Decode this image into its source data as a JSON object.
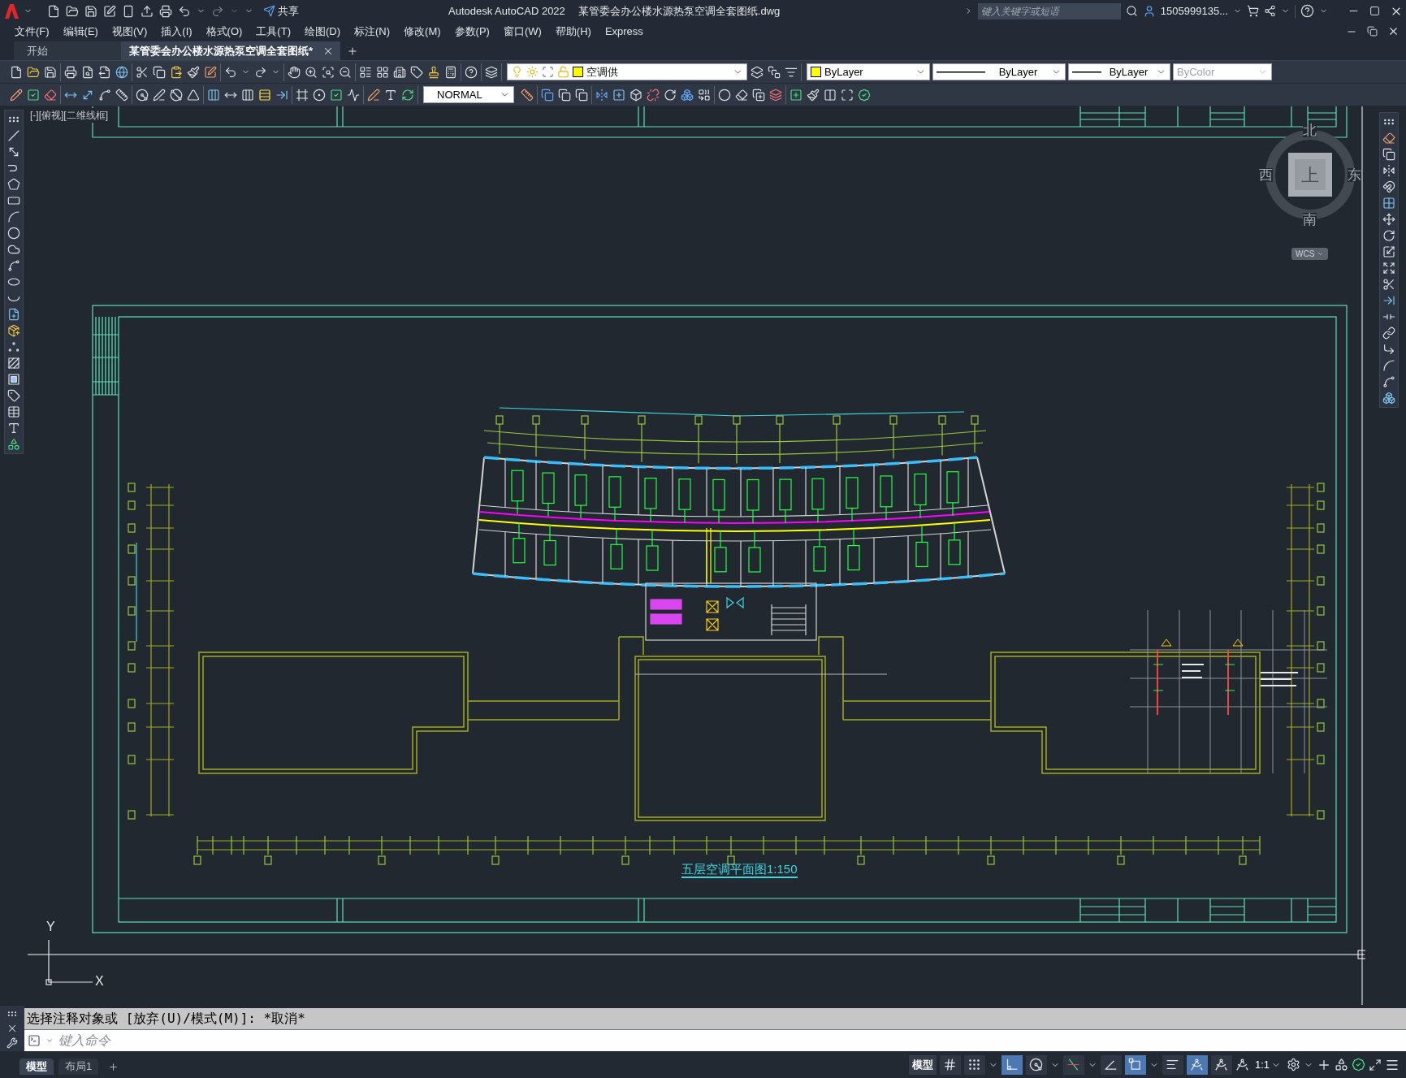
{
  "title_bar": {
    "share_label": "共享",
    "app_name": "Autodesk AutoCAD 2022",
    "document_name": "某管委会办公楼水源热泵空调全套图纸.dwg",
    "search": {
      "placeholder": "键入关键字或短语"
    },
    "user_name": "1505999135..."
  },
  "menu_bar": [
    "文件(F)",
    "编辑(E)",
    "视图(V)",
    "插入(I)",
    "格式(O)",
    "工具(T)",
    "绘图(D)",
    "标注(N)",
    "修改(M)",
    "参数(P)",
    "窗口(W)",
    "帮助(H)",
    "Express"
  ],
  "document_tabs": [
    {
      "label": "开始",
      "selected": false
    },
    {
      "label": "某管委会办公楼水源热泵空调全套图纸*",
      "selected": true
    }
  ],
  "properties_toolbar": {
    "layer": {
      "name": "空调供",
      "color": "#ffff00",
      "on": true,
      "frozen": false,
      "locked": false
    },
    "color_control": {
      "value": "ByLayer",
      "color": "#ffff00"
    },
    "linetype": "ByLayer",
    "lineweight": "ByLayer",
    "plot_style": {
      "value": "ByColor",
      "disabled": true
    }
  },
  "dimension_style": "NORMAL",
  "viewport": {
    "label": "[-][俯视][二维线框]",
    "drawing_title": "五层空调平面图1:150",
    "view_cube": {
      "top_face": "上",
      "north": "北",
      "south": "南",
      "west": "西",
      "east": "东",
      "coordinate_system": "WCS"
    },
    "ucs_icon": {
      "y_label": "Y",
      "x_label": "X"
    }
  },
  "command_line": {
    "history": "选择注释对象或 [放弃(U)/模式(M)]: *取消*",
    "placeholder": "键入命令"
  },
  "layout_tabs": [
    {
      "label": "模型",
      "selected": true
    },
    {
      "label": "布局1",
      "selected": false
    }
  ],
  "status_bar": {
    "space_button": "模型",
    "toggles": [
      {
        "kind": "grid",
        "on": false
      },
      {
        "kind": "snap",
        "on": false
      },
      {
        "kind": "ortho",
        "on": true
      },
      {
        "kind": "polar",
        "on": false
      },
      {
        "kind": "object-snap-tracking",
        "on": false
      },
      {
        "kind": "isometric",
        "on": false
      },
      {
        "kind": "object-snap",
        "on": true
      },
      {
        "kind": "lineweight",
        "on": false
      },
      {
        "kind": "annotation-visibility",
        "on": true
      },
      {
        "kind": "auto-scale",
        "on": false
      }
    ],
    "annotation_scale": "1:1"
  }
}
